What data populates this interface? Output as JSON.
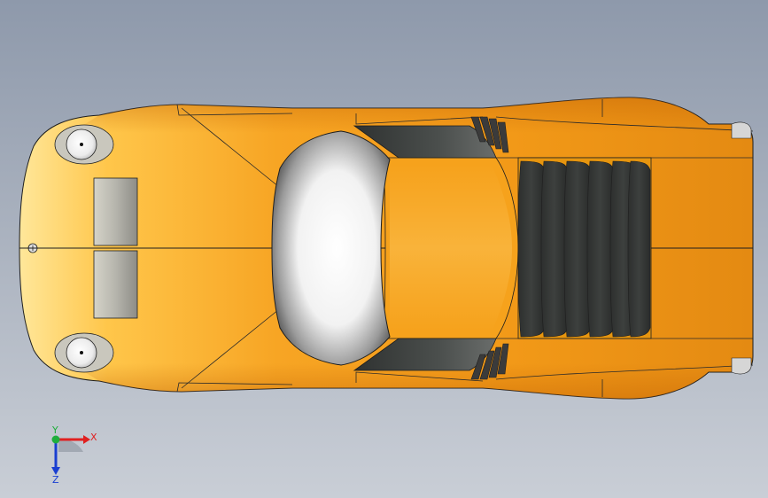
{
  "viewport": {
    "background_top": "#8e99ab",
    "background_bottom": "#c9ced6"
  },
  "model": {
    "body_color": "#f6a21c",
    "highlight_color": "#ffe08a",
    "glass_color": "#e9e9e9",
    "vent_color": "#3a3c3b",
    "edge_color": "#1e1e1e"
  },
  "triad": {
    "x_label": "X",
    "y_label": "Y",
    "z_label": "Z",
    "x_color": "#e02020",
    "y_color": "#1fae3c",
    "z_color": "#1a3fd1"
  }
}
